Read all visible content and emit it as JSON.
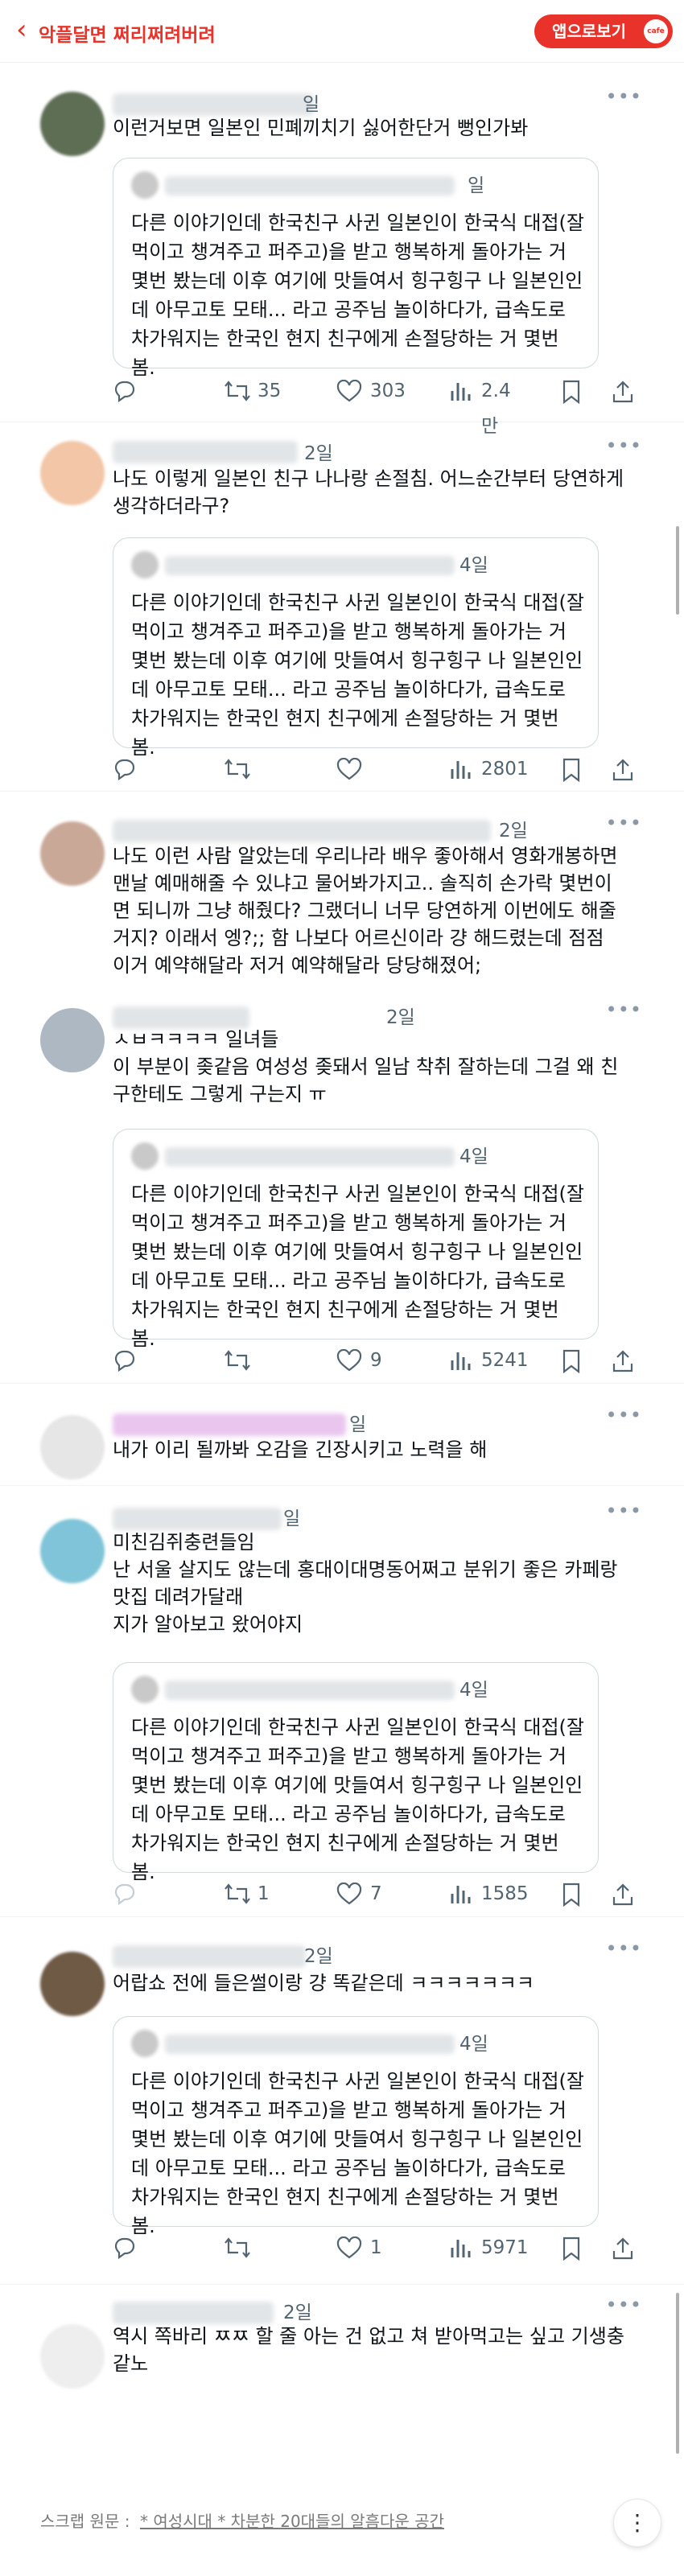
{
  "header": {
    "back_icon": "chevron-left-icon",
    "title": "악플달면 쩌리쩌려버려",
    "app_button": "앱으로보기",
    "app_logo": "cafe",
    "accent": "#e8322a"
  },
  "quote_text": "다른 이야기인데 한국친구 사귄 일본인이 한국식 대접(잘 먹이고 챙겨주고 퍼주고)을 받고 행복하게 돌아가는 거 몇번 봤는데 이후 여기에 맛들여서 힝구힝구 나 일본인인데 아무고토 모태... 라고 공주님 놀이하다가, 급속도로 차가워지는 한국인 현지 친구에게 손절당하는 거 몇번 봄.",
  "posts": [
    {
      "time": "일",
      "text": "이런거보면 일본인 민폐끼치기 싫어한단거 뻥인가봐",
      "quote_time": "일",
      "retweets": "35",
      "likes": "303",
      "views": "2.4만"
    },
    {
      "time": "2일",
      "text": "나도 이렇게 일본인 친구 나나랑 손절침. 어느순간부터 당연하게 생각하더라구?",
      "quote_time": "4일",
      "retweets": "",
      "likes": "",
      "views": "2801"
    },
    {
      "time": "2일",
      "text": "나도 이런 사람 알았는데 우리나라 배우 좋아해서 영화개봉하면 맨날 예매해줄 수 있냐고 물어봐가지고.. 솔직히 손가락 몇번이면 되니까 그냥 해줬다? 그랬더니 너무 당연하게 이번에도 해줄거지? 이래서 엥?;; 함 나보다 어르신이라 걍 해드렸는데 점점 이거 예약해달라 저거 예약해달라 당당해졌어;",
      "quote_time": "",
      "retweets": "",
      "likes": "",
      "views": ""
    },
    {
      "time": "2일",
      "text": "ㅅㅂㅋㅋㅋㅋ 일녀들\n이 부분이 좆같음 여성성 좆돼서 일남 착취 잘하는데 그걸 왜 친구한테도 그렇게 구는지 ㅠ",
      "quote_time": "4일",
      "retweets": "",
      "likes": "9",
      "views": "5241"
    },
    {
      "time": "일",
      "text": "내가 이리 될까봐 오감을 긴장시키고 노력을 해",
      "quote_time": "",
      "retweets": "",
      "likes": "",
      "views": ""
    },
    {
      "time": "일",
      "text": "미친김쥐충련들임\n난 서울 살지도 않는데 홍대이대명동어쩌고 분위기 좋은 카페랑 맛집 데려가달래\n지가 알아보고 왔어야지",
      "quote_time": "4일",
      "retweets": "1",
      "likes": "7",
      "views": "1585"
    },
    {
      "time": "2일",
      "text": "어랍쇼 전에 들은썰이랑 걍 똑같은데 ㅋㅋㅋㅋㅋㅋㅋ",
      "quote_time": "4일",
      "retweets": "",
      "likes": "1",
      "views": "5971"
    },
    {
      "time": "2일",
      "text": "역시 쪽바리 ㅉㅉ 할 줄 아는 건 없고 쳐 받아먹고는 싶고 기생충 같노",
      "quote_time": "",
      "retweets": "",
      "likes": "",
      "views": ""
    }
  ],
  "footer": {
    "source_label": "스크랩 원문 :",
    "source_link": "* 여성시대 * 차분한 20대들의 알흠다운 공간",
    "menu_icon": "vertical-dots-icon"
  }
}
